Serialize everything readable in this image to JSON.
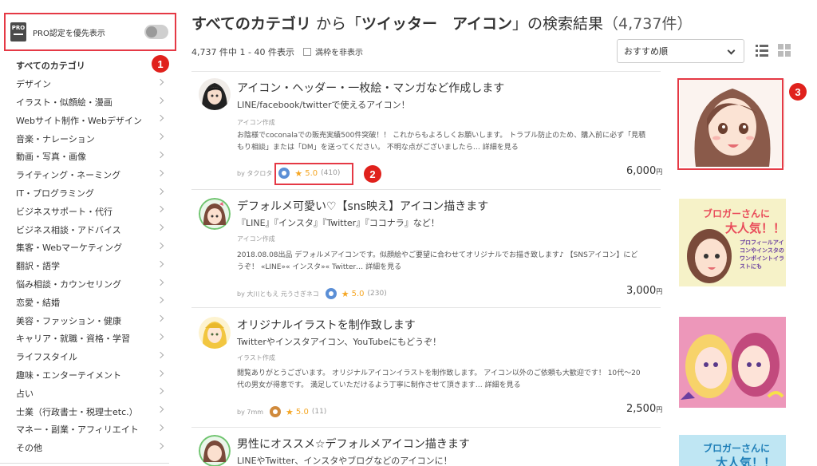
{
  "sidebar": {
    "pro_badge": "PRO",
    "pro_label": "PRO認定を優先表示",
    "categories": [
      {
        "label": "すべてのカテゴリ",
        "active": true
      },
      {
        "label": "デザイン"
      },
      {
        "label": "イラスト・似顔絵・漫画"
      },
      {
        "label": "Webサイト制作・Webデザイン"
      },
      {
        "label": "音楽・ナレーション"
      },
      {
        "label": "動画・写真・画像"
      },
      {
        "label": "ライティング・ネーミング"
      },
      {
        "label": "IT・プログラミング"
      },
      {
        "label": "ビジネスサポート・代行"
      },
      {
        "label": "ビジネス相談・アドバイス"
      },
      {
        "label": "集客・Webマーケティング"
      },
      {
        "label": "翻訳・語学"
      },
      {
        "label": "悩み相談・カウンセリング"
      },
      {
        "label": "恋愛・結婚"
      },
      {
        "label": "美容・ファッション・健康"
      },
      {
        "label": "キャリア・就職・資格・学習"
      },
      {
        "label": "ライフスタイル"
      },
      {
        "label": "趣味・エンターテイメント"
      },
      {
        "label": "占い"
      },
      {
        "label": "士業（行政書士・税理士etc.）"
      },
      {
        "label": "マネー・副業・アフィリエイト"
      },
      {
        "label": "その他"
      }
    ]
  },
  "header": {
    "title_prefix": "すべてのカテゴリ",
    "title_from": " から「",
    "title_query": "ツイッター　アイコン",
    "title_suffix": "」の検索結果",
    "title_count": "（4,737件）",
    "result_count": "4,737 件中 1 - 40 件表示",
    "hide_full_label": "満枠を非表示",
    "sort_value": "おすすめ順"
  },
  "markers": [
    "1",
    "2",
    "3"
  ],
  "listings": [
    {
      "title": "アイコン・ヘッダー・一枚絵・マンガなど作成します",
      "subtitle": "LINE/facebook/twitterで使えるアイコン！",
      "category": "アイコン作成",
      "desc_line1": "お陰様でcoconalaでの販売実績500件突破！！ これからもよろしくお願いします。 トラブル防止のため、購入前に必ず「見積",
      "desc_line2": "もり相談」または「DM」を送ってください。 不明な点がございましたら… ",
      "more": "詳細を見る",
      "by": "by",
      "seller": "タクロタ",
      "rating": "5.0",
      "reviews": "(410)",
      "price": "6,000",
      "yen": "円",
      "badge_color": "#5b8fd6"
    },
    {
      "title": "デフォルメ可愛い♡【sns映え】アイコン描きます",
      "subtitle": "『LINE』『インスタ』『Twitter』『ココナラ』など！",
      "category": "アイコン作成",
      "desc_line1": "2018.08.08出品 デフォルメアイコンです。似顔絵やご要望に合わせてオリジナルでお描き致します♪ 【SNSアイコン】にど",
      "desc_line2": "うぞ！ «LINE»« インスタ»« Twitter… ",
      "more": "詳細を見る",
      "by": "by",
      "seller": "大川ともえ 元うさぎネコ",
      "rating": "5.0",
      "reviews": "(230)",
      "price": "3,000",
      "yen": "円",
      "badge_color": "#5b8fd6",
      "thumb_text_1": "ブロガーさんに",
      "thumb_text_2": "大人気！！",
      "thumb_text_3": "プロフィールアイコンやインスタのワンポイントイラストにも"
    },
    {
      "title": "オリジナルイラストを制作致します",
      "subtitle": "Twitterやインスタアイコン、YouTubeにもどうぞ！",
      "category": "イラスト作成",
      "desc_line1": "閲覧ありがとうございます。 オリジナルアイコンイラストを制作致します。 アイコン以外のご依頼も大歓迎です！ 10代〜20",
      "desc_line2": "代の男女が得意です。 満足していただけるよう丁寧に制作させて頂きます… ",
      "more": "詳細を見る",
      "by": "by",
      "seller": "7mm",
      "rating": "5.0",
      "reviews": "(11)",
      "price": "2,500",
      "yen": "円",
      "badge_color": "#d08a3c"
    },
    {
      "title": "男性にオススメ☆デフォルメアイコン描きます",
      "subtitle": "LINEやTwitter、インスタやブログなどのアイコンに！",
      "thumb_text_1": "ブロガーさんに",
      "thumb_text_2": "大人気！！"
    }
  ]
}
